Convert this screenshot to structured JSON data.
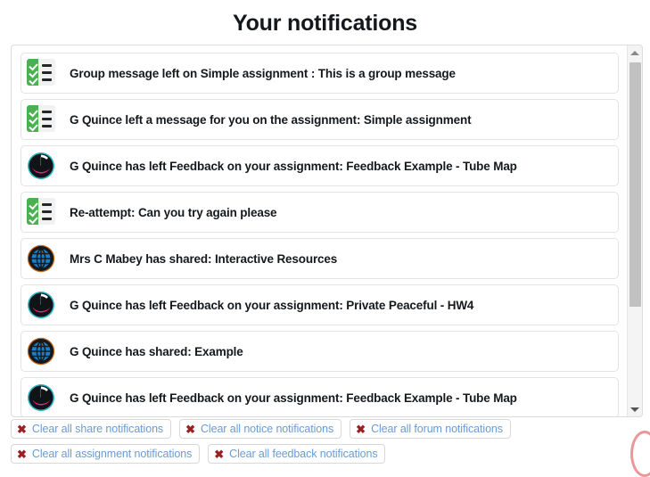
{
  "page": {
    "title": "Your notifications"
  },
  "notifications": [
    {
      "icon": "checklist-icon",
      "text": "Group message left on Simple assignment : This is a group message"
    },
    {
      "icon": "checklist-icon",
      "text": "G Quince left a message for you on the assignment: Simple assignment"
    },
    {
      "icon": "feedback-icon",
      "text": "G Quince has left Feedback on your assignment: Feedback Example - Tube Map"
    },
    {
      "icon": "checklist-icon",
      "text": "Re-attempt: Can you try again please"
    },
    {
      "icon": "globe-icon",
      "text": "Mrs C Mabey has shared: Interactive Resources"
    },
    {
      "icon": "feedback-icon",
      "text": "G Quince has left Feedback on your assignment: Private Peaceful - HW4"
    },
    {
      "icon": "globe-icon",
      "text": "G Quince has shared: Example"
    },
    {
      "icon": "feedback-icon",
      "text": "G Quince has left Feedback on your assignment: Feedback Example - Tube Map"
    }
  ],
  "scrollbar": {
    "up_arrow": "scroll-up-arrow",
    "down_arrow": "scroll-down-arrow"
  },
  "clear_buttons": {
    "row1": [
      {
        "x_glyph": "✖",
        "label": "Clear all share notifications"
      },
      {
        "x_glyph": "✖",
        "label": "Clear all notice notifications"
      },
      {
        "x_glyph": "✖",
        "label": "Clear all forum notifications"
      }
    ],
    "row2": [
      {
        "x_glyph": "✖",
        "label": "Clear all assignment notifications"
      },
      {
        "x_glyph": "✖",
        "label": "Clear all feedback notifications"
      }
    ]
  },
  "colors": {
    "link_blue": "#6b9bd2",
    "x_red": "#9c2022",
    "checklist_green": "#4caf50",
    "globe_blue": "#1d7fc4",
    "globe_ring": "#c86b20",
    "feedback_ring": "#2bb8c8",
    "feedback_pink": "#e8297f",
    "scrollbar_thumb": "#c1c1c1"
  }
}
